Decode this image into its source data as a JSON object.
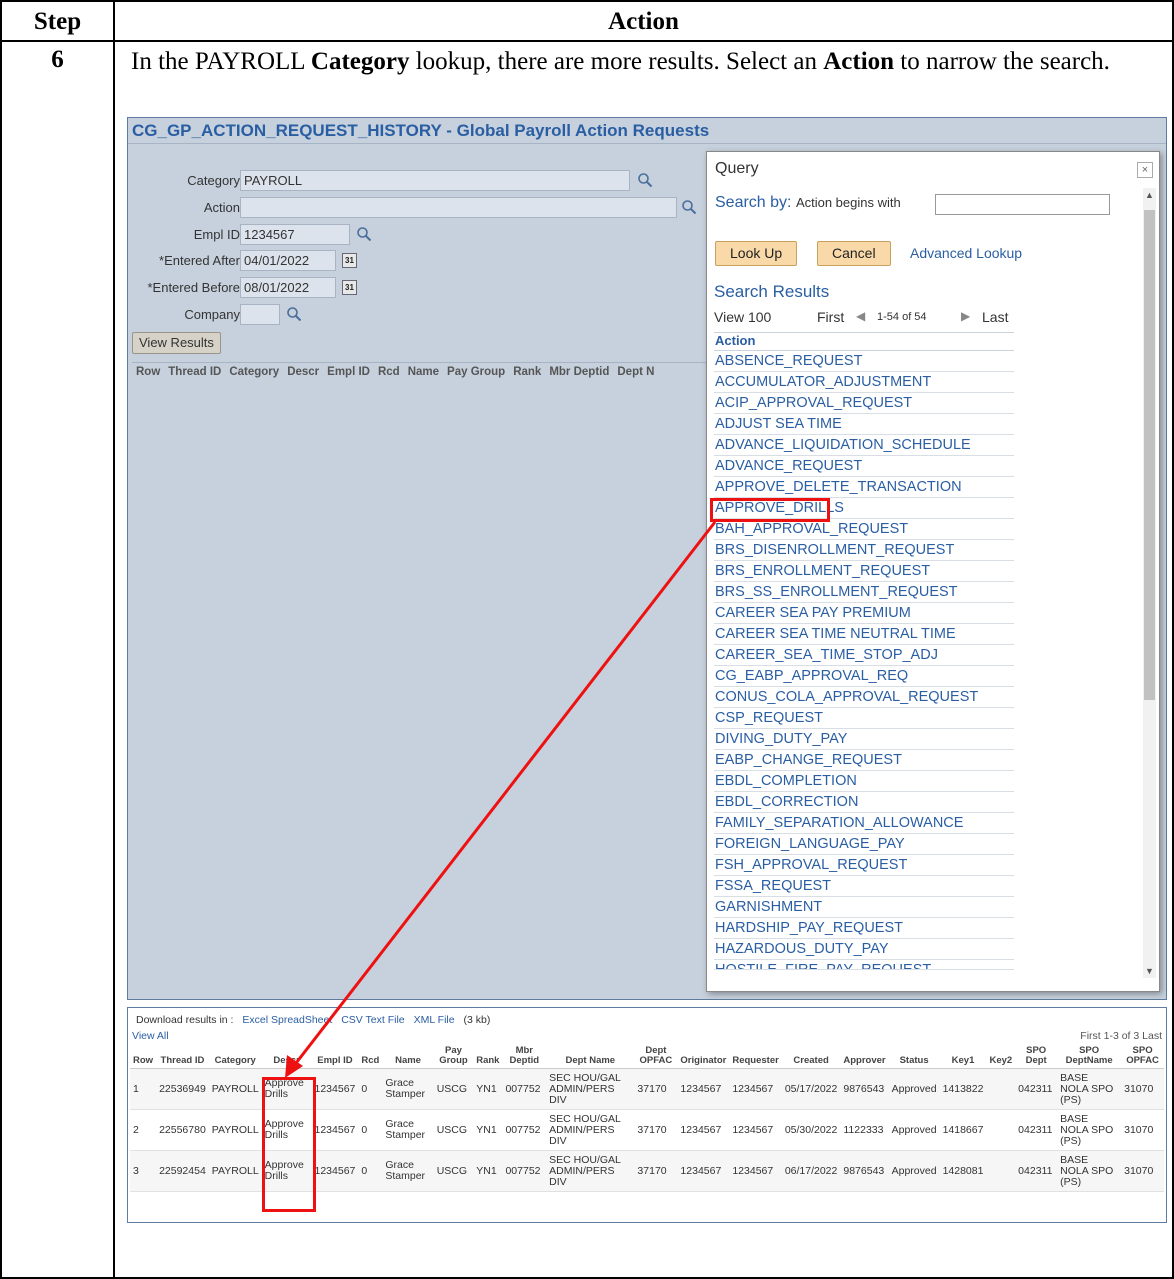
{
  "doc": {
    "step_header": "Step",
    "action_header": "Action",
    "step_number": "6",
    "instruction": {
      "part1": "In the PAYROLL ",
      "bold1": "Category",
      "part2": " lookup, there are more results. Select an ",
      "bold2": "Action",
      "part3": " to narrow the search."
    }
  },
  "page": {
    "title": "CG_GP_ACTION_REQUEST_HISTORY - Global Payroll Action Requests",
    "fields": {
      "category_label": "Category",
      "category_value": "PAYROLL",
      "action_label": "Action",
      "action_value": "",
      "emplid_label": "Empl ID",
      "emplid_value": "1234567",
      "entered_after_label": "*Entered After",
      "entered_after_value": "04/01/2022",
      "entered_before_label": "*Entered Before",
      "entered_before_value": "08/01/2022",
      "company_label": "Company",
      "company_value": ""
    },
    "view_results_button": "View Results",
    "grid_columns": [
      "Row",
      "Thread ID",
      "Category",
      "Descr",
      "Empl ID",
      "Rcd",
      "Name",
      "Pay Group",
      "Rank",
      "Mbr Deptid",
      "Dept N"
    ]
  },
  "modal": {
    "title": "Query",
    "close": "×",
    "search_by_label": "Search by:",
    "search_by_field": "Action begins with",
    "lookup_button": "Look Up",
    "cancel_button": "Cancel",
    "advanced_lookup": "Advanced Lookup",
    "results_title": "Search Results",
    "view_label": "View 100",
    "first_label": "First",
    "range_label": "1-54 of 54",
    "last_label": "Last",
    "results_column": "Action",
    "results": [
      "ABSENCE_REQUEST",
      "ACCUMULATOR_ADJUSTMENT",
      "ACIP_APPROVAL_REQUEST",
      "ADJUST SEA TIME",
      "ADVANCE_LIQUIDATION_SCHEDULE",
      "ADVANCE_REQUEST",
      "APPROVE_DELETE_TRANSACTION",
      "APPROVE_DRILLS",
      "BAH_APPROVAL_REQUEST",
      "BRS_DISENROLLMENT_REQUEST",
      "BRS_ENROLLMENT_REQUEST",
      "BRS_SS_ENROLLMENT_REQUEST",
      "CAREER SEA PAY PREMIUM",
      "CAREER SEA TIME NEUTRAL TIME",
      "CAREER_SEA_TIME_STOP_ADJ",
      "CG_EABP_APPROVAL_REQ",
      "CONUS_COLA_APPROVAL_REQUEST",
      "CSP_REQUEST",
      "DIVING_DUTY_PAY",
      "EABP_CHANGE_REQUEST",
      "EBDL_COMPLETION",
      "EBDL_CORRECTION",
      "FAMILY_SEPARATION_ALLOWANCE",
      "FOREIGN_LANGUAGE_PAY",
      "FSH_APPROVAL_REQUEST",
      "FSSA_REQUEST",
      "GARNISHMENT",
      "HARDSHIP_PAY_REQUEST",
      "HAZARDOUS_DUTY_PAY",
      "HOSTILE_FIRE_PAY_REQUEST"
    ]
  },
  "results_table": {
    "download_label": "Download results in :",
    "excel": "Excel SpreadSheet",
    "csv": "CSV Text File",
    "xml": "XML File",
    "size": "(3 kb)",
    "view_all": "View All",
    "paging": "First  1-3 of 3  Last",
    "headers": [
      "Row",
      "Thread ID",
      "Category",
      "Descr",
      "Empl ID",
      "Rcd",
      "Name",
      "Pay Group",
      "Rank",
      "Mbr Deptid",
      "Dept Name",
      "Dept OPFAC",
      "Originator",
      "Requester",
      "Created",
      "Approver",
      "Status",
      "Key1",
      "Key2",
      "SPO Dept",
      "SPO DeptName",
      "SPO OPFAC"
    ],
    "rows": [
      [
        "1",
        "22536949",
        "PAYROLL",
        "Approve Drills",
        "1234567",
        "0",
        "Grace Stamper",
        "USCG",
        "YN1",
        "007752",
        "SEC HOU/GAL ADMIN/PERS DIV",
        "37170",
        "1234567",
        "1234567",
        "05/17/2022",
        "9876543",
        "Approved",
        "1413822",
        "",
        "042311",
        "BASE NOLA SPO (PS)",
        "31070"
      ],
      [
        "2",
        "22556780",
        "PAYROLL",
        "Approve Drills",
        "1234567",
        "0",
        "Grace Stamper",
        "USCG",
        "YN1",
        "007752",
        "SEC HOU/GAL ADMIN/PERS DIV",
        "37170",
        "1234567",
        "1234567",
        "05/30/2022",
        "1122333",
        "Approved",
        "1418667",
        "",
        "042311",
        "BASE NOLA SPO (PS)",
        "31070"
      ],
      [
        "3",
        "22592454",
        "PAYROLL",
        "Approve Drills",
        "1234567",
        "0",
        "Grace Stamper",
        "USCG",
        "YN1",
        "007752",
        "SEC HOU/GAL ADMIN/PERS DIV",
        "37170",
        "1234567",
        "1234567",
        "06/17/2022",
        "9876543",
        "Approved",
        "1428081",
        "",
        "042311",
        "BASE NOLA SPO (PS)",
        "31070"
      ]
    ]
  },
  "colors": {
    "annotation_red": "#ee1111",
    "link_blue": "#2a5ea3",
    "page_bg": "#c7d1dd"
  }
}
